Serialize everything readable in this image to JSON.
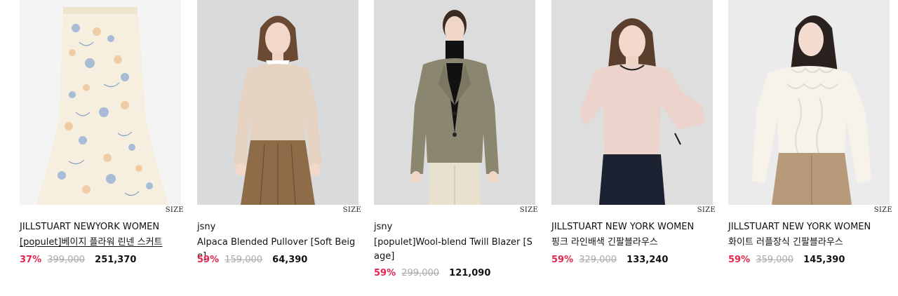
{
  "size_label": "SIZE",
  "products": [
    {
      "brand": "JILLSTUART NEWYORK WOMEN",
      "name": "[populet]베이지 플라워 린넨 스커트",
      "discount": "37%",
      "original_price": "399,000",
      "sale_price": "251,370"
    },
    {
      "brand": "jsny",
      "name": "Alpaca Blended Pullover [Soft Beige]",
      "discount": "59%",
      "original_price": "159,000",
      "sale_price": "64,390"
    },
    {
      "brand": "jsny",
      "name": "[populet]Wool-blend Twill Blazer [Sage]",
      "discount": "59%",
      "original_price": "299,000",
      "sale_price": "121,090"
    },
    {
      "brand": "JILLSTUART NEW YORK WOMEN",
      "name": "핑크 라인배색 긴팔블라우스",
      "discount": "59%",
      "original_price": "329,000",
      "sale_price": "133,240"
    },
    {
      "brand": "JILLSTUART NEW YORK WOMEN",
      "name": "화이트 러플장식 긴팔블라우스",
      "discount": "59%",
      "original_price": "359,000",
      "sale_price": "145,390"
    }
  ],
  "colors": {
    "discount": "#e2264d",
    "original_price": "#aaaaaa",
    "text": "#111111"
  }
}
